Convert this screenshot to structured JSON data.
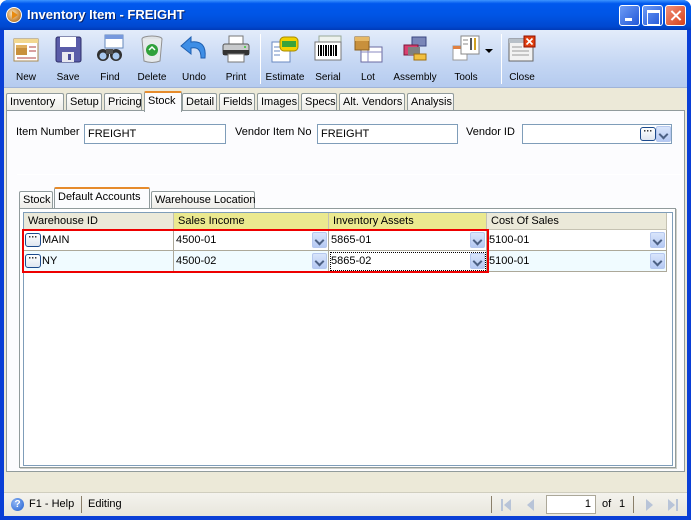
{
  "window": {
    "title": "Inventory Item - FREIGHT",
    "controls": [
      "minimize",
      "maximize",
      "close"
    ]
  },
  "toolbar": {
    "buttons": [
      {
        "id": "new",
        "label": "New",
        "icon": "new-item-icon"
      },
      {
        "id": "save",
        "label": "Save",
        "icon": "floppy-disk-icon"
      },
      {
        "id": "find",
        "label": "Find",
        "icon": "binoculars-icon"
      },
      {
        "id": "delete",
        "label": "Delete",
        "icon": "recycle-bin-icon"
      },
      {
        "id": "undo",
        "label": "Undo",
        "icon": "undo-arrow-icon"
      },
      {
        "id": "print",
        "label": "Print",
        "icon": "printer-icon"
      },
      {
        "id": "estimate",
        "label": "Estimate",
        "icon": "estimate-icon"
      },
      {
        "id": "serial",
        "label": "Serial",
        "icon": "barcode-icon"
      },
      {
        "id": "lot",
        "label": "Lot",
        "icon": "lot-box-icon"
      },
      {
        "id": "assembly",
        "label": "Assembly",
        "icon": "assembly-icon"
      },
      {
        "id": "tools",
        "label": "Tools",
        "icon": "tools-icon"
      },
      {
        "id": "close",
        "label": "Close",
        "icon": "close-window-icon"
      }
    ]
  },
  "tabs": [
    "Inventory",
    "Setup",
    "Pricing",
    "Stock",
    "Detail",
    "Fields",
    "Images",
    "Specs",
    "Alt. Vendors",
    "Analysis"
  ],
  "active_tab": "Stock",
  "form": {
    "item_number_label": "Item Number",
    "item_number_value": "FREIGHT",
    "vendor_item_no_label": "Vendor Item No",
    "vendor_item_no_value": "FREIGHT",
    "vendor_id_label": "Vendor ID",
    "vendor_id_value": ""
  },
  "subtabs": [
    "Stock",
    "Default Accounts",
    "Warehouse Location"
  ],
  "active_subtab": "Default Accounts",
  "grid": {
    "columns": [
      "Warehouse ID",
      "Sales Income",
      "Inventory Assets",
      "Cost Of Sales"
    ],
    "highlighted_columns": [
      "Sales Income",
      "Inventory Assets"
    ],
    "rows": [
      {
        "warehouse_id": "MAIN",
        "sales_income": "4500-01",
        "inventory_assets": "5865-01",
        "cost_of_sales": "5100-01"
      },
      {
        "warehouse_id": "NY",
        "sales_income": "4500-02",
        "inventory_assets": "5865-02",
        "cost_of_sales": "5100-01"
      }
    ],
    "ellipsis": "···"
  },
  "status": {
    "help": "F1 - Help",
    "mode": "Editing",
    "page": "1",
    "of_label": "of",
    "total_pages": "1"
  },
  "colors": {
    "title_bar": "#0055e5",
    "highlight_header": "#ebe98f",
    "selection_border": "#e00000",
    "alt_row": "#f0fbff"
  }
}
